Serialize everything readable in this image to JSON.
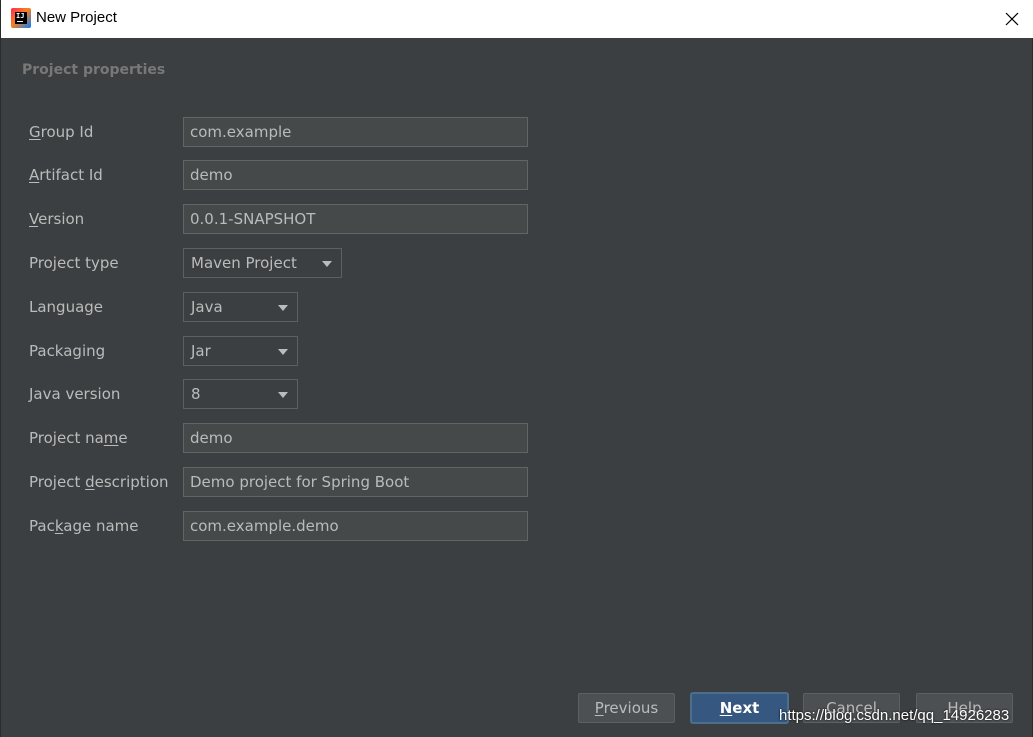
{
  "window": {
    "title": "New Project"
  },
  "section_title": "Project properties",
  "fields": {
    "group_id": {
      "label_pre": "",
      "label_mn": "G",
      "label_post": "roup Id",
      "value": "com.example"
    },
    "artifact_id": {
      "label_pre": "",
      "label_mn": "A",
      "label_post": "rtifact Id",
      "value": "demo"
    },
    "version": {
      "label_pre": "",
      "label_mn": "V",
      "label_post": "ersion",
      "value": "0.0.1-SNAPSHOT"
    },
    "project_type": {
      "label": "Project type",
      "value": "Maven Project"
    },
    "language": {
      "label": "Language",
      "value": "Java"
    },
    "packaging": {
      "label": "Packaging",
      "value": "Jar"
    },
    "java_version": {
      "label": "Java version",
      "value": "8"
    },
    "project_name": {
      "label_pre": "Project na",
      "label_mn": "m",
      "label_post": "e",
      "value": "demo"
    },
    "project_description": {
      "label_pre": "Project ",
      "label_mn": "d",
      "label_post": "escription",
      "value": "Demo project for Spring Boot"
    },
    "package_name": {
      "label_pre": "Pac",
      "label_mn": "k",
      "label_post": "age name",
      "value": "com.example.demo"
    }
  },
  "buttons": {
    "previous": {
      "mn": "P",
      "rest": "revious"
    },
    "next": {
      "mn": "N",
      "rest": "ext"
    },
    "cancel": {
      "label": "Cancel"
    },
    "help": {
      "label": "Help"
    }
  },
  "watermark": "https://blog.csdn.net/qq_14926283",
  "colors": {
    "background": "#3c3f41",
    "field_bg": "#45494a",
    "primary_button": "#365880"
  },
  "icons": [
    "intellij-idea-icon",
    "close-icon",
    "dropdown-arrow-icon"
  ]
}
